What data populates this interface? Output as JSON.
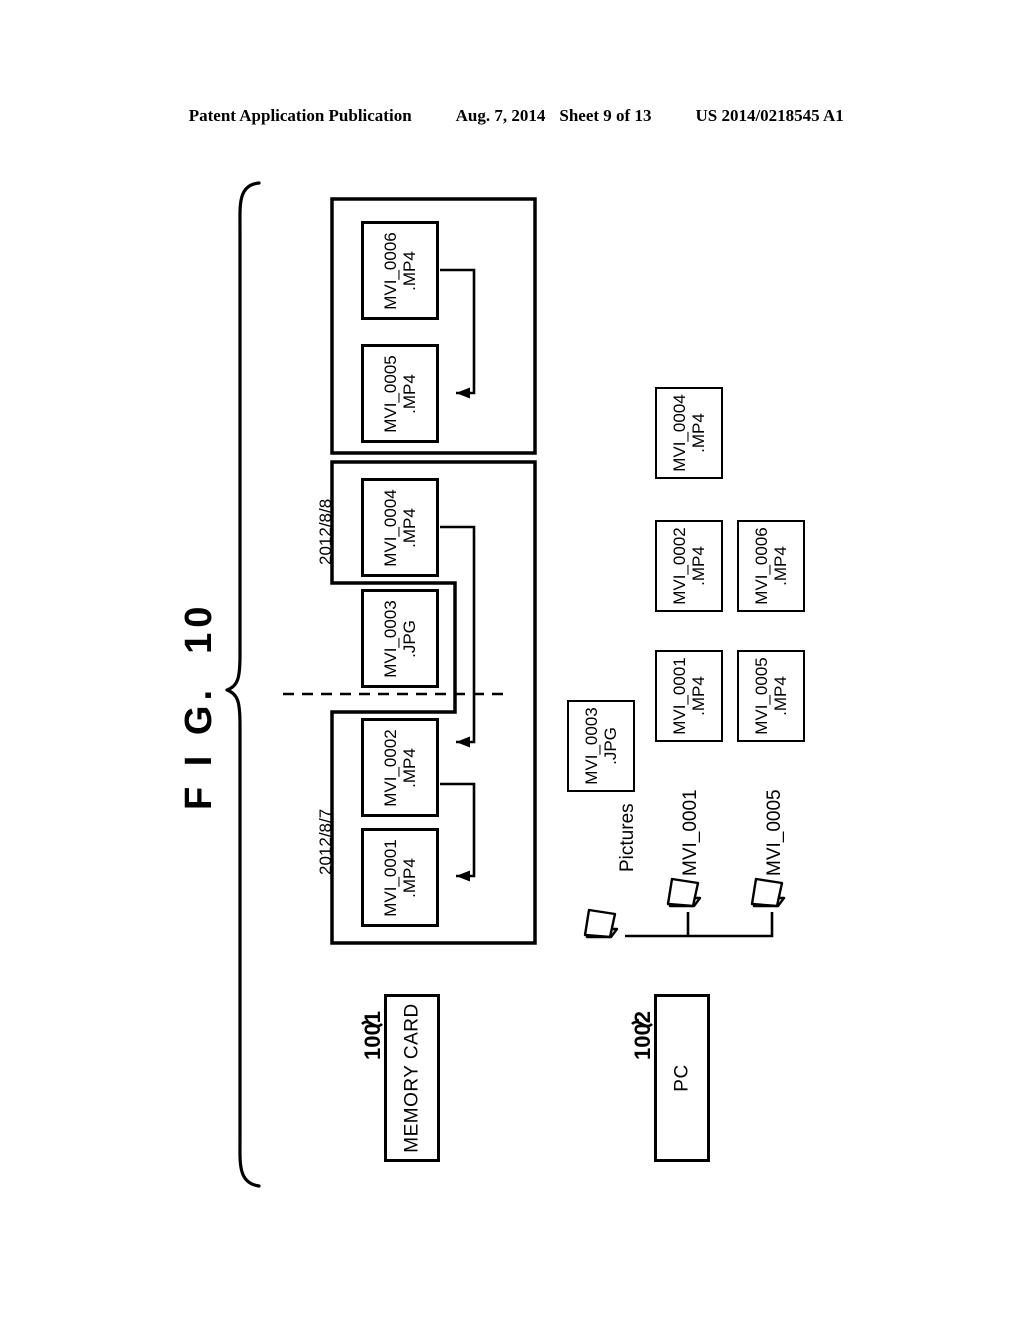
{
  "header": {
    "publication": "Patent Application Publication",
    "date": "Aug. 7, 2014",
    "sheet": "Sheet 9 of 13",
    "patent_number": "US 2014/0218545 A1"
  },
  "figure": {
    "title": "F I G.  10"
  },
  "memory_card": {
    "ref": "1001",
    "label": "MEMORY CARD",
    "groups": [
      {
        "date": "2012/8/8",
        "files": [
          "MVI_0006\n.MP4",
          "MVI_0005\n.MP4"
        ],
        "links": [
          {
            "from": "MVI_0006.MP4",
            "to": "MVI_0005.MP4"
          }
        ]
      },
      {
        "date": "2012/8/7",
        "files": [
          "MVI_0004\n.MP4",
          "MVI_0003\n.JPG",
          "MVI_0002\n.MP4",
          "MVI_0001\n.MP4"
        ],
        "links": [
          {
            "from": "MVI_0004.MP4",
            "to": "MVI_0002.MP4"
          },
          {
            "from": "MVI_0002.MP4",
            "to": "MVI_0001.MP4"
          }
        ]
      }
    ]
  },
  "pc": {
    "ref": "1002",
    "label": "PC",
    "files": [
      "MVI_0004\n.MP4",
      "MVI_0002\n.MP4",
      "MVI_0006\n.MP4",
      "MVI_0001\n.MP4",
      "MVI_0005\n.MP4",
      "MVI_0003\n.JPG"
    ],
    "tree": {
      "root": "Pictures",
      "children": [
        "MVI_0001",
        "MVI_0005"
      ]
    }
  },
  "colors": {
    "ink": "#000000",
    "paper": "#ffffff"
  }
}
